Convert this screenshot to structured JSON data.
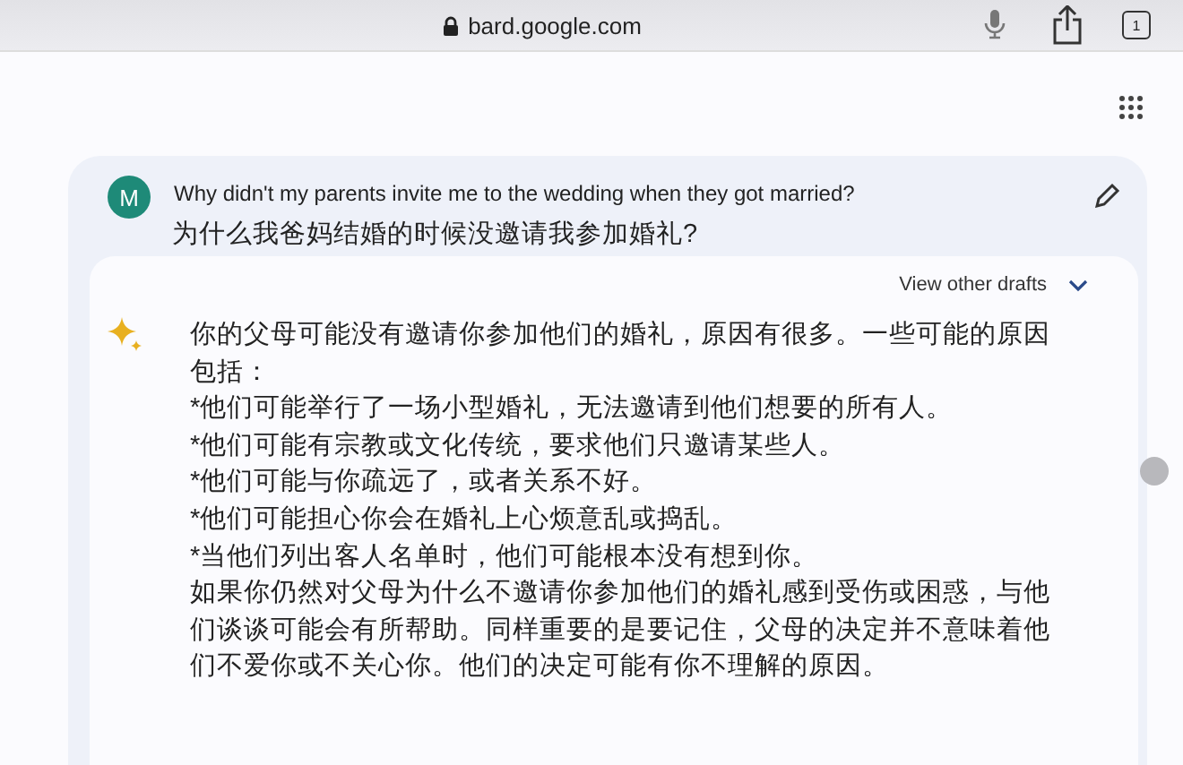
{
  "browser": {
    "url": "bard.google.com",
    "tab_count": "1"
  },
  "prompt": {
    "avatar": "M",
    "text": "Why didn't my parents invite me to the wedding when they got married?",
    "translation": "为什么我爸妈结婚的时候没邀请我参加婚礼?"
  },
  "response": {
    "drafts_link": "View other drafts",
    "lines": [
      "你的父母可能没有邀请你参加他们的婚礼，原因有很多。一些可能的原因",
      "包括：",
      "*他们可能举行了一场小型婚礼，无法邀请到他们想要的所有人。",
      "*他们可能有宗教或文化传统，要求他们只邀请某些人。",
      "*他们可能与你疏远了，或者关系不好。",
      "*他们可能担心你会在婚礼上心烦意乱或捣乱。",
      "*当他们列出客人名单时，他们可能根本没有想到你。",
      "如果你仍然对父母为什么不邀请你参加他们的婚礼感到受伤或困惑，与他",
      "们谈谈可能会有所帮助。同样重要的是要记住，父母的决定并不意味着他",
      "们不爱你或不关心你。他们的决定可能有你不理解的原因。"
    ]
  }
}
